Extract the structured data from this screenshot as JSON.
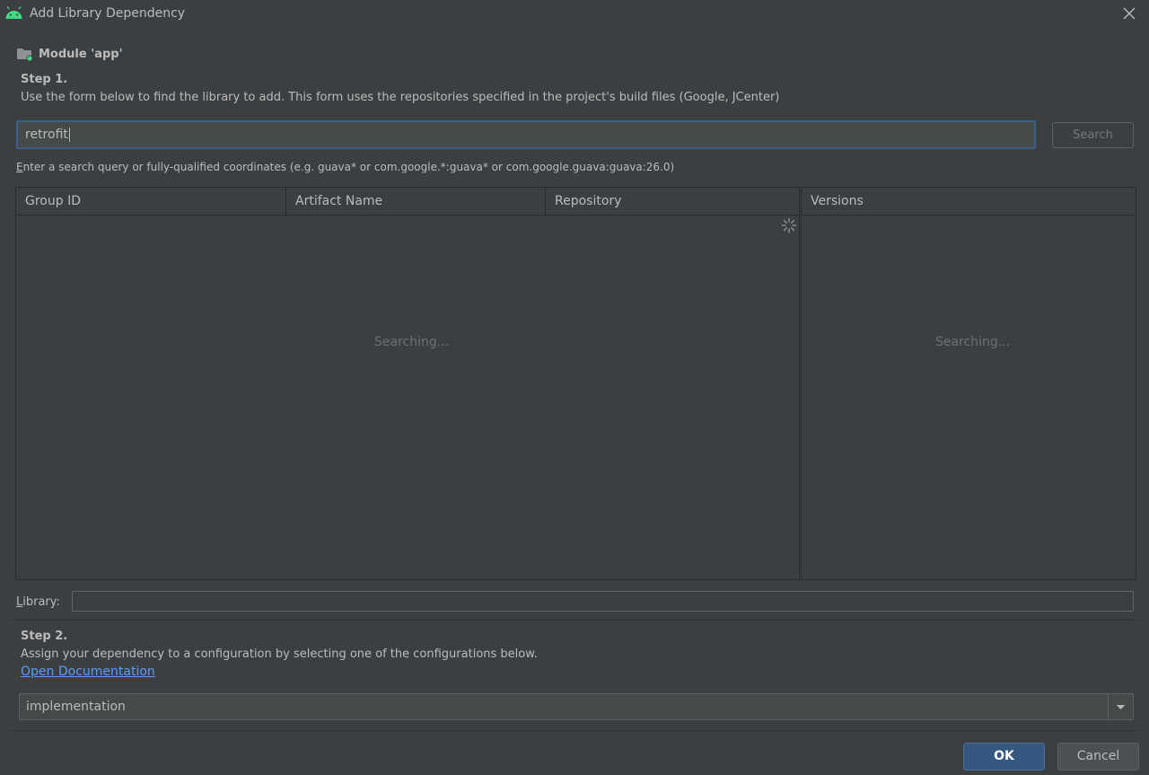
{
  "window": {
    "title": "Add Library Dependency",
    "app_icon": "android-icon",
    "close_icon": "close-icon"
  },
  "module": {
    "icon": "module-folder-icon",
    "label": "Module 'app'"
  },
  "step1": {
    "title": "Step 1.",
    "description": "Use the form below to find the library to add. This form uses the repositories specified in the project's build files (Google, JCenter)"
  },
  "search": {
    "value": "retrofit",
    "button_label": "Search",
    "hint_mnemonic": "E",
    "hint_rest": "nter a search query or fully-qualified coordinates (e.g. guava* or com.google.*:guava* or com.google.guava:guava:26.0)"
  },
  "results_table": {
    "columns": [
      "Group ID",
      "Artifact Name",
      "Repository"
    ],
    "status": "Searching..."
  },
  "versions_table": {
    "columns": [
      "Versions"
    ],
    "status": "Searching..."
  },
  "library": {
    "label_mnemonic": "L",
    "label_rest": "ibrary:",
    "value": ""
  },
  "step2": {
    "title": "Step 2.",
    "description": "Assign your dependency to a configuration by selecting one of the configurations below.",
    "doc_link": "Open Documentation"
  },
  "configuration": {
    "selected": "implementation"
  },
  "footer": {
    "ok_label": "OK",
    "cancel_label": "Cancel"
  },
  "colors": {
    "accent": "#365880",
    "link": "#589df6",
    "focus_border": "#3d6185",
    "android_green": "#3ddc84"
  }
}
